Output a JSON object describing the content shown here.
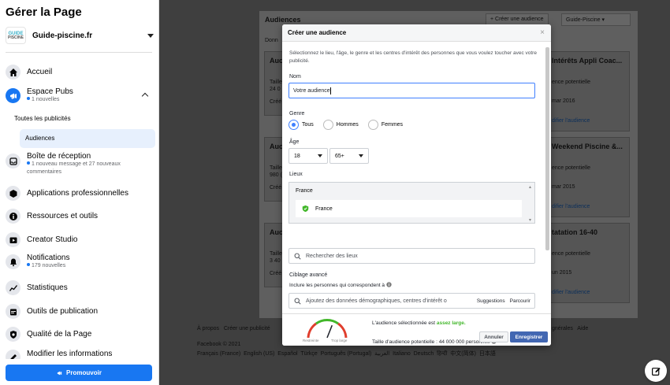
{
  "sidebar": {
    "title": "Gérer la Page",
    "page": {
      "name": "Guide-piscine.fr",
      "avatar_line1": "GUIDE",
      "avatar_line2": "PISCINE"
    },
    "items": [
      {
        "label": "Accueil"
      },
      {
        "label": "Espace Pubs",
        "sub": "1 nouvelles"
      },
      {
        "label": "Boîte de réception",
        "sub": "1 nouveau message et 27 nouveaux commentaires"
      },
      {
        "label": "Applications professionnelles"
      },
      {
        "label": "Ressources et outils"
      },
      {
        "label": "Creator Studio"
      },
      {
        "label": "Notifications",
        "sub": "179 nouvelles"
      },
      {
        "label": "Statistiques"
      },
      {
        "label": "Outils de publication"
      },
      {
        "label": "Qualité de la Page"
      },
      {
        "label": "Modifier les informations"
      }
    ],
    "sublinks": {
      "all_ads": "Toutes les publicités",
      "audiences": "Audiences"
    },
    "promote_label": "Promouvoir"
  },
  "background": {
    "header": "Audiences",
    "create_btn": "Créer une audience",
    "page_select": "Guide-Piscine",
    "data_label": "Donn",
    "card_prefix": "Auc",
    "cards": [
      {
        "title": "Intérêts Appli Coac...",
        "size_label": "ence potentielle",
        "date": "mar 2016",
        "link": "difier l'audience"
      },
      {
        "title": "Weekend Piscine &...",
        "size_label": "ence potentielle",
        "date": "mar 2015",
        "link": "difier l'audience"
      },
      {
        "title": "tatation 16-40",
        "size_label": "ence potentielle",
        "date": "un 2015",
        "link": "difier l'audience"
      }
    ],
    "left_cards": [
      {
        "l1": "Taille",
        "l2": "24 0",
        "l3": "Créé"
      },
      {
        "l1": "Taille",
        "l2": "980 (",
        "l3": "Créé"
      },
      {
        "l1": "Taille",
        "l2": "3 40",
        "l3": "Créé"
      }
    ],
    "footer_links": "À propos   Créer une publicité",
    "footer_right": "gnérales   Aide",
    "copyright": "Facebook © 2021",
    "languages": "Français (France)  English (US)  Español  Türkçe  Português (Portugal)  العربية  Italiano  Deutsch  हिन्दी  中文(简体)  日本語"
  },
  "modal": {
    "title": "Créer une audience",
    "intro": "Sélectionnez le lieu, l'âge, le genre et les centres d'intérêt des personnes que vous voulez toucher avec votre publicité.",
    "name_label": "Nom",
    "name_value": "Votre audience",
    "gender_label": "Genre",
    "gender_options": [
      "Tous",
      "Hommes",
      "Femmes"
    ],
    "gender_selected": "Tous",
    "age_label": "Âge",
    "age_min": "18",
    "age_max": "65+",
    "locations_label": "Lieux",
    "location_group": "France",
    "location_item": "France",
    "location_search_placeholder": "Rechercher des lieux",
    "advanced_label": "Ciblage avancé",
    "include_label": "Inclure les personnes qui correspondent à",
    "interest_placeholder": "Ajoutez des données démographiques, centres d'intérêt o",
    "suggestions": "Suggestions",
    "browse": "Parcourir",
    "gauge_low": "Restreinte",
    "gauge_high": "Trop large",
    "gauge_level": 0.62,
    "audience_text": "L'audience sélectionnée est",
    "audience_quality": "assez large.",
    "size_text": "Taille d'audience potentielle : 44 000 000 personnes",
    "cancel": "Annuler",
    "save": "Enregistrer"
  }
}
